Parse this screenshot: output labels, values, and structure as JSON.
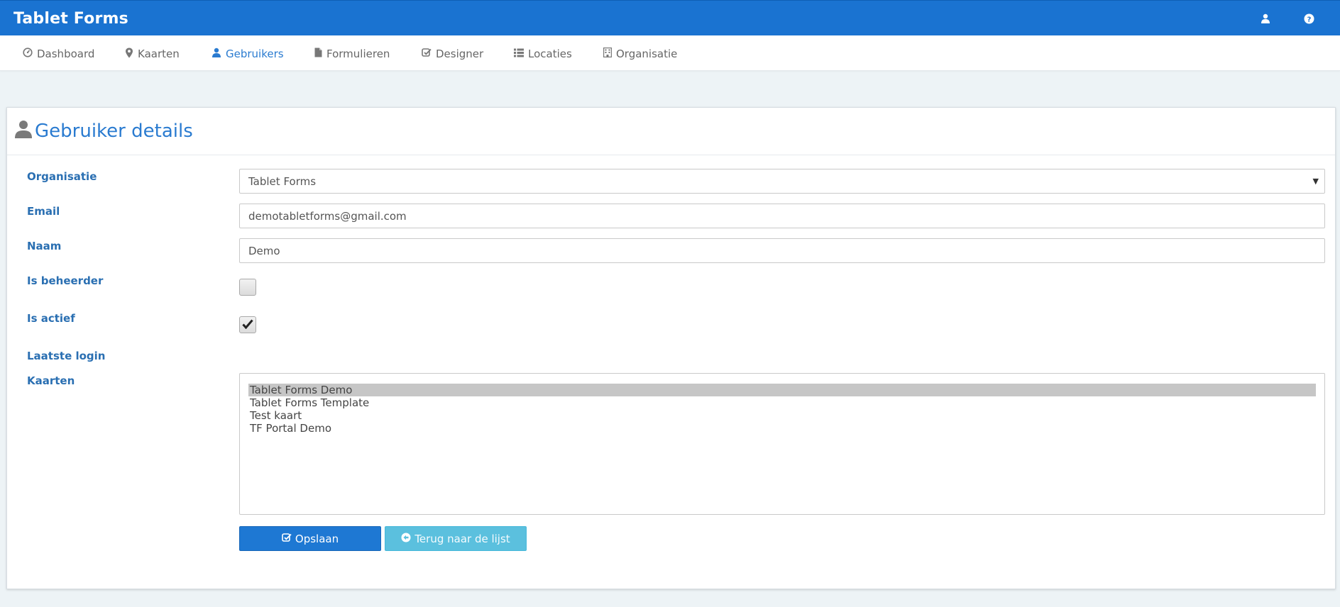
{
  "app": {
    "title": "Tablet Forms"
  },
  "topbar": {
    "icons": [
      "user-icon",
      "question-icon"
    ]
  },
  "nav": {
    "items": [
      {
        "label": "Dashboard",
        "icon": "dashboard-icon",
        "active": false
      },
      {
        "label": "Kaarten",
        "icon": "map-marker-icon",
        "active": false
      },
      {
        "label": "Gebruikers",
        "icon": "user-icon",
        "active": true
      },
      {
        "label": "Formulieren",
        "icon": "file-icon",
        "active": false
      },
      {
        "label": "Designer",
        "icon": "check-square-icon",
        "active": false
      },
      {
        "label": "Locaties",
        "icon": "list-icon",
        "active": false
      },
      {
        "label": "Organisatie",
        "icon": "building-icon",
        "active": false
      }
    ]
  },
  "panel": {
    "title": "Gebruiker details",
    "icon": "user-icon"
  },
  "form": {
    "organisatie": {
      "label": "Organisatie",
      "value": "Tablet Forms"
    },
    "email": {
      "label": "Email",
      "value": "demotabletforms@gmail.com"
    },
    "naam": {
      "label": "Naam",
      "value": "Demo"
    },
    "is_beheerder": {
      "label": "Is beheerder",
      "checked": false
    },
    "is_actief": {
      "label": "Is actief",
      "checked": true
    },
    "laatste_login": {
      "label": "Laatste login",
      "value": ""
    },
    "kaarten": {
      "label": "Kaarten",
      "options": [
        "Tablet Forms Demo",
        "Tablet Forms Template",
        "Test kaart",
        "TF Portal Demo"
      ],
      "selected": "Tablet Forms Demo"
    }
  },
  "buttons": {
    "save_label": "Opslaan",
    "back_label": "Terug naar de lijst"
  },
  "colors": {
    "primary": "#1a73d1",
    "link": "#2a7bd0",
    "label": "#2a6fb2",
    "info": "#5bc0de",
    "background": "#edf3f6"
  }
}
